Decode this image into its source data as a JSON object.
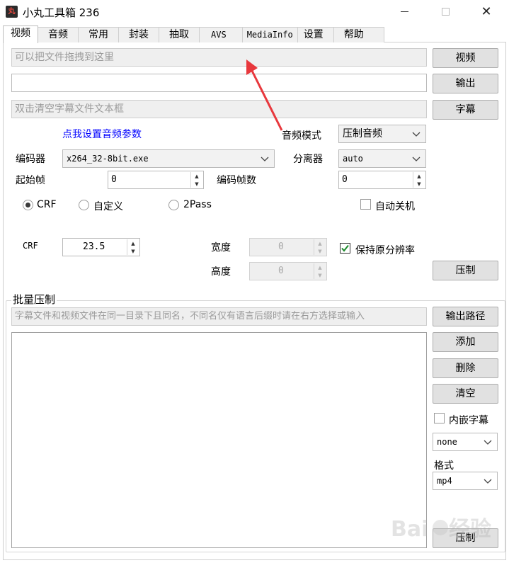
{
  "window": {
    "title": "小丸工具箱 236",
    "icon_label": "丸"
  },
  "tabs": [
    {
      "label": "视频",
      "active": true
    },
    {
      "label": "音频"
    },
    {
      "label": "常用"
    },
    {
      "label": "封装"
    },
    {
      "label": "抽取"
    },
    {
      "label": "AVS"
    },
    {
      "label": "MediaInfo"
    },
    {
      "label": "设置"
    },
    {
      "label": "帮助"
    }
  ],
  "video": {
    "drop_placeholder": "可以把文件拖拽到这里",
    "output_value": "",
    "subtitle_placeholder": "双击清空字幕文件文本框",
    "video_button": "视频",
    "output_button": "输出",
    "subtitle_button": "字幕",
    "audio_settings_link": "点我设置音频参数",
    "audio_mode_label": "音频模式",
    "audio_mode_value": "压制音频",
    "encoder_label": "编码器",
    "encoder_value": "x264_32-8bit.exe",
    "demuxer_label": "分离器",
    "demuxer_value": "auto",
    "start_frame_label": "起始帧",
    "start_frame_value": "0",
    "encode_frames_label": "编码帧数",
    "encode_frames_value": "0",
    "radio_crf": "CRF",
    "radio_custom": "自定义",
    "radio_2pass": "2Pass",
    "auto_shutdown_label": "自动关机",
    "crf_label": "CRF",
    "crf_value": "23.5",
    "width_label": "宽度",
    "width_value": "0",
    "height_label": "高度",
    "height_value": "0",
    "keep_resolution_label": "保持原分辨率",
    "encode_button": "压制"
  },
  "batch": {
    "group_title": "批量压制",
    "hint_placeholder": "字幕文件和视频文件在同一目录下且同名，不同名仅有语言后缀时请在右方选择或输入",
    "output_path_button": "输出路径",
    "add_button": "添加",
    "delete_button": "删除",
    "clear_button": "清空",
    "embed_subtitle_label": "内嵌字幕",
    "subtitle_lang_value": "none",
    "format_label": "格式",
    "format_value": "mp4",
    "encode_button": "压制"
  },
  "colors": {
    "link_blue": "#0000ff",
    "annotation_red": "#e8383d",
    "check_green": "#1a8a2a"
  }
}
